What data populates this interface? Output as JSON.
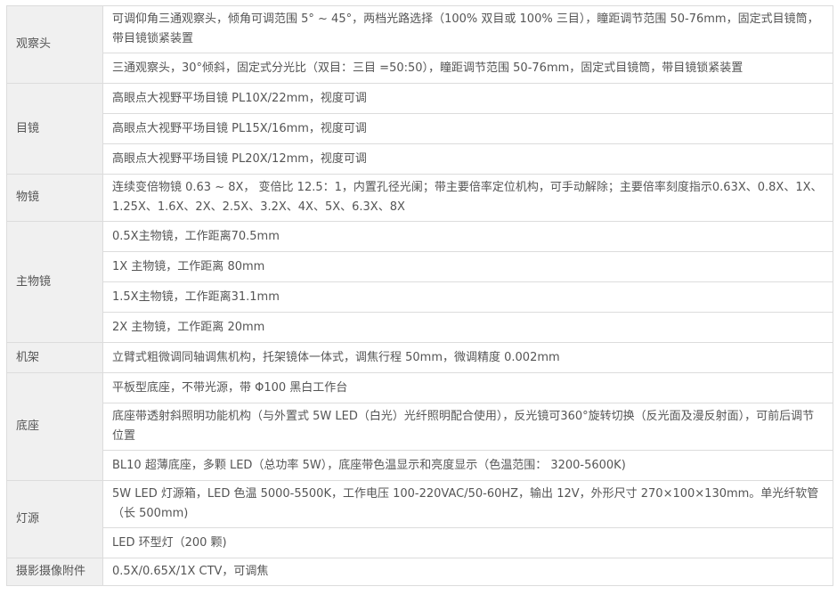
{
  "rows": [
    {
      "category": "观察头",
      "specs": [
        "可调仰角三通观察头，倾角可调范围 5° ~ 45°，两档光路选择（100% 双目或 100% 三目），瞳距调节范围 50-76mm，固定式目镜筒，带目镜锁紧装置",
        "三通观察头，30°倾斜，固定式分光比（双目：三目 =50:50），瞳距调节范围 50-76mm，固定式目镜筒，带目镜锁紧装置"
      ]
    },
    {
      "category": "目镜",
      "specs": [
        "高眼点大视野平场目镜 PL10X/22mm，视度可调",
        "高眼点大视野平场目镜 PL15X/16mm，视度可调",
        "高眼点大视野平场目镜 PL20X/12mm，视度可调"
      ]
    },
    {
      "category": "物镜",
      "specs": [
        "连续变倍物镜 0.63 ~ 8X， 变倍比 12.5：1，内置孔径光阑；带主要倍率定位机构，可手动解除；主要倍率刻度指示0.63X、0.8X、1X、1.25X、1.6X、2X、2.5X、3.2X、4X、5X、6.3X、8X"
      ]
    },
    {
      "category": "主物镜",
      "specs": [
        "0.5X主物镜，工作距离70.5mm",
        "1X 主物镜，工作距离 80mm",
        "1.5X主物镜，工作距离31.1mm",
        "2X 主物镜，工作距离 20mm"
      ]
    },
    {
      "category": "机架",
      "specs": [
        "立臂式粗微调同轴调焦机构，托架镜体一体式，调焦行程 50mm，微调精度 0.002mm"
      ]
    },
    {
      "category": "底座",
      "specs": [
        "平板型底座，不带光源，带 Φ100 黑白工作台",
        "底座带透射斜照明功能机构（与外置式 5W LED（白光）光纤照明配合使用），反光镜可360°旋转切换（反光面及漫反射面），可前后调节位置",
        "BL10 超薄底座，多颗 LED（总功率 5W），底座带色温显示和亮度显示（色温范围： 3200-5600K)"
      ]
    },
    {
      "category": "灯源",
      "specs": [
        "5W LED 灯源箱，LED 色温 5000-5500K，工作电压 100-220VAC/50-60HZ，输出 12V，外形尺寸 270×100×130mm。单光纤软管（长 500mm)",
        "LED 环型灯（200 颗)"
      ]
    },
    {
      "category": "摄影摄像附件",
      "specs": [
        "0.5X/0.65X/1X CTV，可调焦"
      ]
    }
  ]
}
